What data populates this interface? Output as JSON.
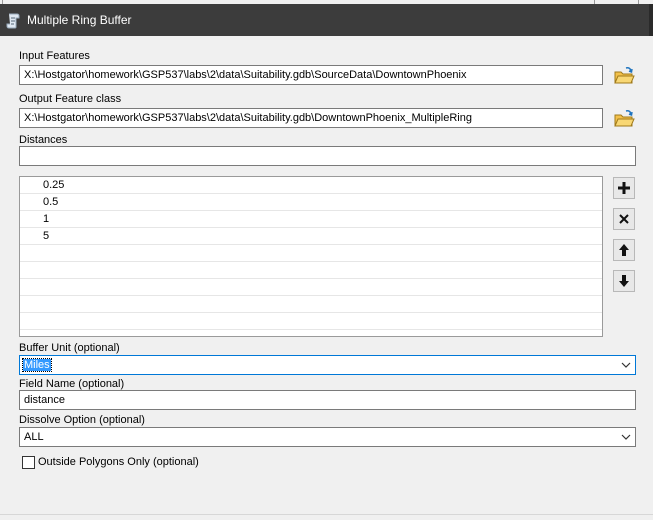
{
  "window": {
    "title": "Multiple Ring Buffer",
    "icon": "script-tool-icon"
  },
  "input_features": {
    "label": "Input Features",
    "value": "X:\\Hostgator\\homework\\GSP537\\labs\\2\\data\\Suitability.gdb\\SourceData\\DowntownPhoenix"
  },
  "output_feature_class": {
    "label": "Output Feature class",
    "value": "X:\\Hostgator\\homework\\GSP537\\labs\\2\\data\\Suitability.gdb\\DowntownPhoenix_MultipleRing"
  },
  "distances": {
    "label": "Distances",
    "input_value": "",
    "items": [
      "0.25",
      "0.5",
      "1",
      "5"
    ]
  },
  "buffer_unit": {
    "label": "Buffer Unit (optional)",
    "value": "Miles"
  },
  "field_name": {
    "label": "Field Name (optional)",
    "value": "distance"
  },
  "dissolve_option": {
    "label": "Dissolve Option (optional)",
    "value": "ALL"
  },
  "outside_polygons_only": {
    "label": "Outside Polygons Only (optional)",
    "checked": false
  },
  "colors": {
    "titlebar": "#3c3c3c",
    "selection": "#3399ff",
    "focus_border": "#0078d7"
  }
}
